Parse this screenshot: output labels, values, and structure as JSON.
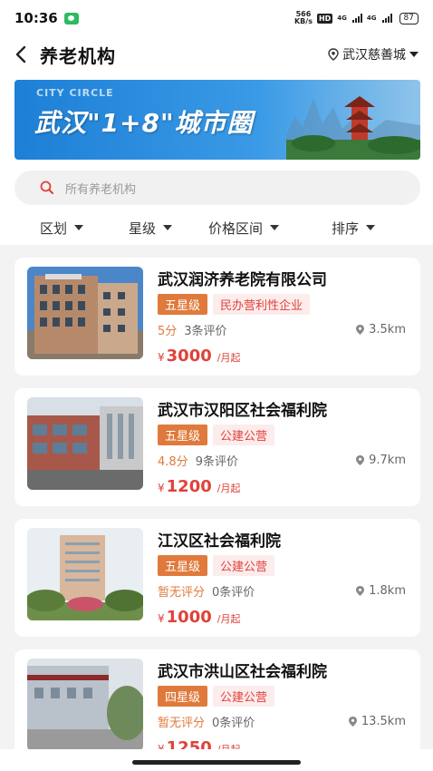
{
  "status_bar": {
    "time": "10:36",
    "net_speed_top": "566",
    "net_speed_bottom": "KB/s",
    "hd": "HD",
    "sig1": "4G",
    "sig2": "4G",
    "battery": "87"
  },
  "header": {
    "title": "养老机构",
    "location": "武汉慈善城"
  },
  "banner": {
    "small_text": "CITY CIRCLE",
    "title": "武汉\"1+8\"城市圈"
  },
  "search": {
    "placeholder": "所有养老机构"
  },
  "filters": [
    "区划",
    "星级",
    "价格区间",
    "排序"
  ],
  "colors": {
    "accent": "#e0413a",
    "star_tag": "#e07a3c",
    "type_tag_bg": "#fdecec"
  },
  "cards": [
    {
      "name": "武汉润济养老院有限公司",
      "star": "五星级",
      "type": "民办营利性企业",
      "score": "5分",
      "reviews": "3条评价",
      "distance": "3.5km",
      "price_symbol": "¥",
      "price": "3000",
      "price_unit": "/月起"
    },
    {
      "name": "武汉市汉阳区社会福利院",
      "star": "五星级",
      "type": "公建公营",
      "score": "4.8分",
      "reviews": "9条评价",
      "distance": "9.7km",
      "price_symbol": "¥",
      "price": "1200",
      "price_unit": "/月起"
    },
    {
      "name": "江汉区社会福利院",
      "star": "五星级",
      "type": "公建公营",
      "score": "暂无评分",
      "reviews": "0条评价",
      "distance": "1.8km",
      "price_symbol": "¥",
      "price": "1000",
      "price_unit": "/月起"
    },
    {
      "name": "武汉市洪山区社会福利院",
      "star": "四星级",
      "type": "公建公营",
      "score": "暂无评分",
      "reviews": "0条评价",
      "distance": "13.5km",
      "price_symbol": "¥",
      "price": "1250",
      "price_unit": "/月起"
    }
  ]
}
